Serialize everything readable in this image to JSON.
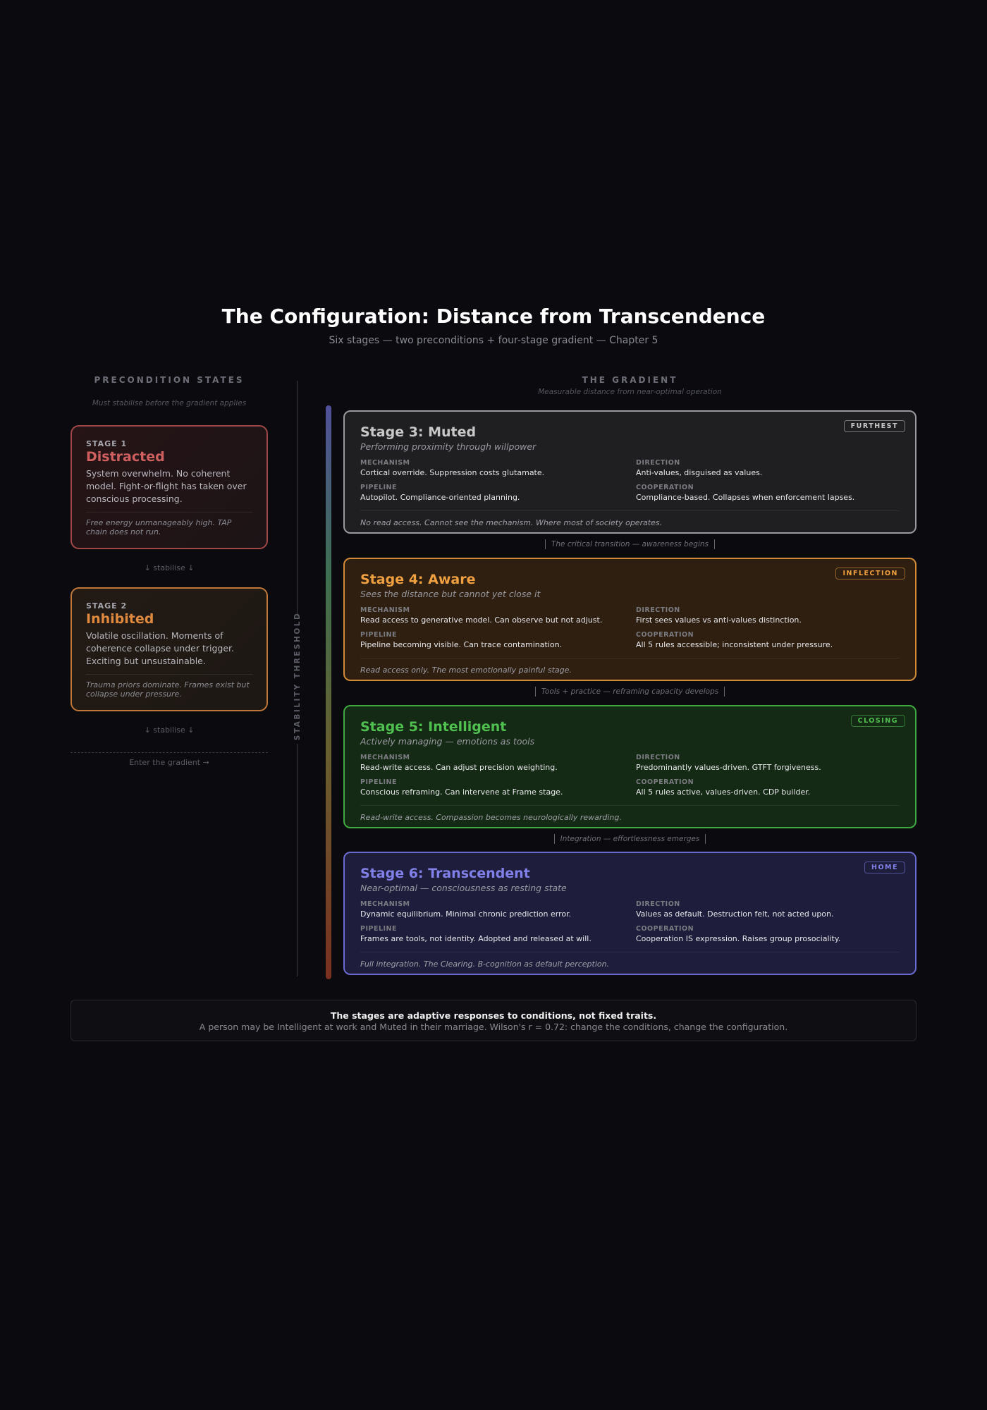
{
  "header": {
    "title": "The Configuration: Distance from Transcendence",
    "subtitle": "Six stages — two preconditions + four-stage gradient — Chapter 5"
  },
  "preconditions": {
    "heading": "PRECONDITION STATES",
    "subheading": "Must stabilise before the gradient applies",
    "stages": [
      {
        "tag": "STAGE 1",
        "name": "Distracted",
        "desc": "System overwhelm. No coherent model. Fight-or-flight has taken over conscious processing.",
        "note": "Free energy unmanageably high. TAP chain does not run.",
        "color": "#d06060"
      },
      {
        "tag": "STAGE 2",
        "name": "Inhibited",
        "desc": "Volatile oscillation. Moments of coherence collapse under trigger. Exciting but unsustainable.",
        "note": "Trauma priors dominate. Frames exist but collapse under pressure.",
        "color": "#e08a40"
      }
    ],
    "stabilise": "↓ stabilise ↓",
    "enter": "Enter the gradient →"
  },
  "threshold_label": "STABILITY THRESHOLD",
  "gradient": {
    "heading": "THE GRADIENT",
    "subheading": "Measurable distance from near-optimal operation",
    "labels": {
      "mechanism": "MECHANISM",
      "direction": "DIRECTION",
      "pipeline": "PIPELINE",
      "cooperation": "COOPERATION"
    },
    "stages": [
      {
        "name": "Stage 3: Muted",
        "sub": "Performing proximity through willpower",
        "badge": "FURTHEST",
        "mechanism": "Cortical override. Suppression costs glutamate.",
        "direction": "Anti-values, disguised as values.",
        "pipeline": "Autopilot. Compliance-oriented planning.",
        "cooperation": "Compliance-based. Collapses when enforcement lapses.",
        "note": "No read access. Cannot see the mechanism. Where most of society operates.",
        "color": "#c8c8c8"
      },
      {
        "name": "Stage 4: Aware",
        "sub": "Sees the distance but cannot yet close it",
        "badge": "INFLECTION",
        "mechanism": "Read access to generative model. Can observe but not adjust.",
        "direction": "First sees values vs anti-values distinction.",
        "pipeline": "Pipeline becoming visible. Can trace contamination.",
        "cooperation": "All 5 rules accessible; inconsistent under pressure.",
        "note": "Read access only. The most emotionally painful stage.",
        "color": "#f0a040"
      },
      {
        "name": "Stage 5: Intelligent",
        "sub": "Actively managing — emotions as tools",
        "badge": "CLOSING",
        "mechanism": "Read-write access. Can adjust precision weighting.",
        "direction": "Predominantly values-driven. GTFT forgiveness.",
        "pipeline": "Conscious reframing. Can intervene at Frame stage.",
        "cooperation": "All 5 rules active, values-driven. CDP builder.",
        "note": "Read-write access. Compassion becomes neurologically rewarding.",
        "color": "#50c050"
      },
      {
        "name": "Stage 6: Transcendent",
        "sub": "Near-optimal — consciousness as resting state",
        "badge": "HOME",
        "mechanism": "Dynamic equilibrium. Minimal chronic prediction error.",
        "direction": "Values as default. Destruction felt, not acted upon.",
        "pipeline": "Frames are tools, not identity. Adopted and released at will.",
        "cooperation": "Cooperation IS expression. Raises group prosociality.",
        "note": "Full integration. The Clearing. B-cognition as default perception.",
        "color": "#8080e8"
      }
    ],
    "transitions": [
      "The critical transition — awareness begins",
      "Tools + practice — reframing capacity develops",
      "Integration — effortlessness emerges"
    ]
  },
  "footer": {
    "bold": "The stages are adaptive responses to conditions, not fixed traits.",
    "text": "A person may be Intelligent at work and Muted in their marriage. Wilson's r = 0.72: change the conditions, change the configuration."
  }
}
